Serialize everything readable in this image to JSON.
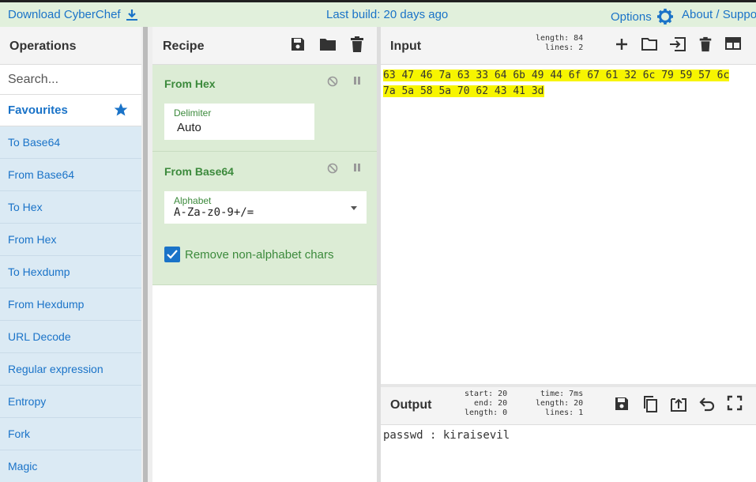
{
  "topbar": {
    "download_label": "Download CyberChef",
    "last_build": "Last build: 20 days ago",
    "options_label": "Options",
    "about_label": "About / Support"
  },
  "operations": {
    "title": "Operations",
    "search_placeholder": "Search...",
    "favourites_label": "Favourites",
    "items": [
      "To Base64",
      "From Base64",
      "To Hex",
      "From Hex",
      "To Hexdump",
      "From Hexdump",
      "URL Decode",
      "Regular expression",
      "Entropy",
      "Fork",
      "Magic"
    ]
  },
  "recipe": {
    "title": "Recipe",
    "ops": [
      {
        "name": "From Hex",
        "field_label": "Delimiter",
        "field_value": "Auto"
      },
      {
        "name": "From Base64",
        "field_label": "Alphabet",
        "field_value": "A-Za-z0-9+/=",
        "checkbox_label": "Remove non-alphabet chars",
        "checkbox_checked": true
      }
    ]
  },
  "input": {
    "title": "Input",
    "stats": {
      "length": "length: 84",
      "lines": "lines:  2"
    },
    "lines": [
      "63 47 46 7a 63 33 64 6b 49 44 6f 67 61 32 6c 79 59 57 6c",
      "7a 5a 58 5a 70 62 43 41 3d "
    ]
  },
  "output": {
    "title": "Output",
    "stats": {
      "start": "start: 20",
      "end": "end: 20",
      "length": "length:  0",
      "time": "time:  7ms",
      "length2": "length:  20",
      "lines": "lines:   1"
    },
    "text": "passwd : kiraisevil"
  },
  "colors": {
    "accent": "#1a73c8",
    "op_bg": "#dcecd5",
    "highlight": "#f7f500",
    "topbar_bg": "#e1f0dc"
  }
}
